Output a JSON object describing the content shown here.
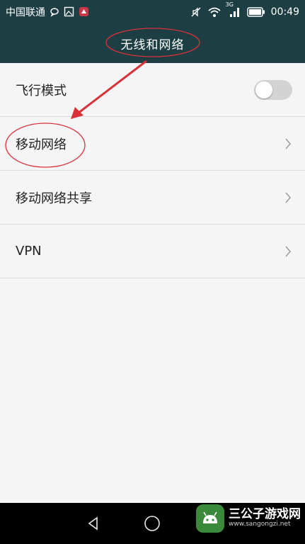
{
  "status_bar": {
    "carrier": "中国联通",
    "network_label": "3G",
    "time": "00:49",
    "icons": [
      "message-icon",
      "gallery-icon",
      "app-notification-icon",
      "mute-icon",
      "wifi-icon",
      "signal-icon",
      "battery-icon"
    ]
  },
  "app_bar": {
    "title": "无线和网络"
  },
  "settings": [
    {
      "label": "飞行模式",
      "control": "toggle",
      "on": false
    },
    {
      "label": "移动网络",
      "control": "chevron"
    },
    {
      "label": "移动网络共享",
      "control": "chevron"
    },
    {
      "label": "VPN",
      "control": "chevron"
    }
  ],
  "nav_bar": {
    "buttons": [
      "back-icon",
      "home-icon",
      "recents-icon"
    ]
  },
  "watermark": {
    "name": "三公子游戏网",
    "url": "www.sangongzi.net"
  },
  "colors": {
    "header": "#1d3f44",
    "annotation": "#d9313a",
    "background": "#f5f5f5"
  }
}
